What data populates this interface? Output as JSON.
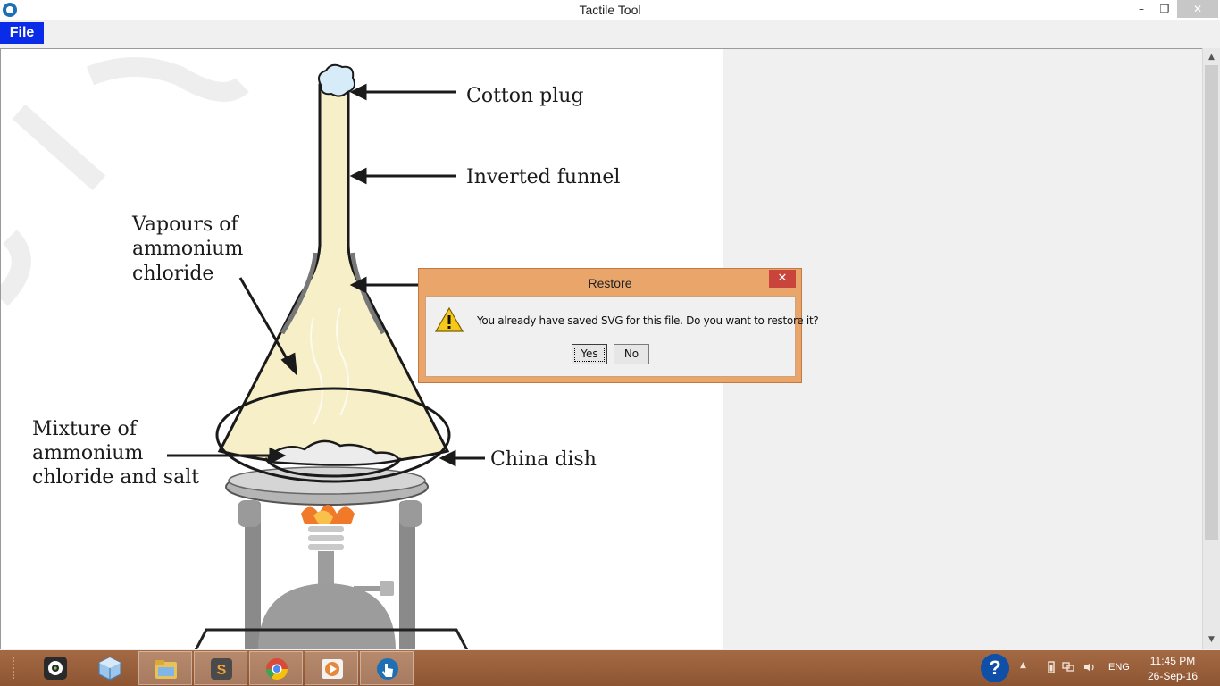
{
  "window": {
    "title": "Tactile Tool",
    "minimize_glyph": "–",
    "maximize_glyph": "❐",
    "close_glyph": "✕"
  },
  "menubar": {
    "file_label": "File"
  },
  "diagram": {
    "labels": {
      "cotton_plug": "Cotton plug",
      "inverted_funnel": "Inverted funnel",
      "vapours_line1": "Vapours of",
      "vapours_line2": "ammonium",
      "vapours_line3": "chloride",
      "mixture_line1": "Mixture of",
      "mixture_line2": "ammonium",
      "mixture_line3": "chloride and salt",
      "china_dish": "China dish"
    },
    "colors": {
      "funnel_fill": "#f7efc8",
      "stand_gray": "#8f8f8f",
      "flame_orange": "#f07a2a",
      "plug_blue": "#d6ecf8"
    }
  },
  "dialog": {
    "title": "Restore",
    "close_glyph": "✕",
    "icon": "warning-icon",
    "message": "You already have saved SVG for this file. Do you want to restore it?",
    "yes_label": "Yes",
    "no_label": "No"
  },
  "scrollbar": {
    "up_glyph": "▲",
    "down_glyph": "▼"
  },
  "taskbar": {
    "apps": [
      {
        "name": "camera-app-icon",
        "color": "#2a2a2a"
      },
      {
        "name": "box-app-icon",
        "color": "#7fb2e0"
      },
      {
        "name": "file-explorer-icon",
        "color": "#e9c15a"
      },
      {
        "name": "sublime-text-icon",
        "color": "#4a4a4a"
      },
      {
        "name": "chrome-icon",
        "color": "#d94a38"
      },
      {
        "name": "media-player-icon",
        "color": "#e8873a"
      },
      {
        "name": "tactile-tool-icon",
        "color": "#1f6fb5"
      }
    ],
    "help_glyph": "?",
    "tray_up_glyph": "▲",
    "language": "ENG",
    "time": "11:45 PM",
    "date": "26-Sep-16"
  }
}
